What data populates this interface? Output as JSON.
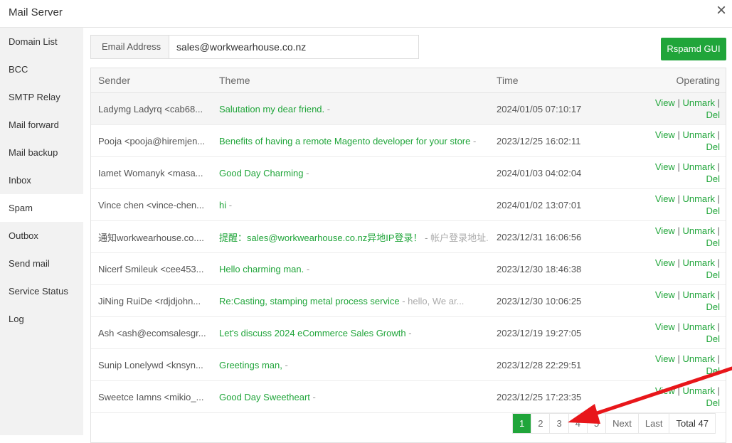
{
  "window": {
    "title": "Mail Server",
    "close_icon": "×"
  },
  "sidebar": {
    "items": [
      {
        "label": "Domain List"
      },
      {
        "label": "BCC"
      },
      {
        "label": "SMTP Relay"
      },
      {
        "label": "Mail forward"
      },
      {
        "label": "Mail backup"
      },
      {
        "label": "Inbox"
      },
      {
        "label": "Spam",
        "active": true
      },
      {
        "label": "Outbox"
      },
      {
        "label": "Send mail"
      },
      {
        "label": "Service Status"
      },
      {
        "label": "Log"
      }
    ]
  },
  "email": {
    "label": "Email Address",
    "value": "sales@workwearhouse.co.nz"
  },
  "rspamd_button": "Rspamd GUI",
  "table": {
    "headers": {
      "sender": "Sender",
      "theme": "Theme",
      "time": "Time",
      "operating": "Operating"
    },
    "actions": {
      "view": "View",
      "unmark": "Unmark",
      "del": "Del",
      "separator": "|"
    },
    "rows": [
      {
        "sender": "Ladymg Ladyrq <cab68...",
        "subject": "Salutation my dear friend.",
        "sep": " -",
        "body": "",
        "time": "2024/01/05 07:10:17"
      },
      {
        "sender": "Pooja <pooja@hiremjen...",
        "subject": "Benefits of having a remote Magento developer for your store",
        "sep": " -",
        "body": "",
        "time": "2023/12/25 16:02:11"
      },
      {
        "sender": "Iamet Womanyk <masa...",
        "subject": "Good Day Charming",
        "sep": " -",
        "body": "",
        "time": "2024/01/03 04:02:04"
      },
      {
        "sender": "Vince chen <vince-chen...",
        "subject": "hi",
        "sep": " -",
        "body": "",
        "time": "2024/01/02 13:07:01"
      },
      {
        "sender": "通知workwearhouse.co....",
        "subject": "提醒：sales@workwearhouse.co.nz异地IP登录！",
        "sep": " -",
        "body": " 帐户登录地址...",
        "time": "2023/12/31 16:06:56"
      },
      {
        "sender": "Nicerf Smileuk <cee453...",
        "subject": "Hello charming man.",
        "sep": " -",
        "body": "",
        "time": "2023/12/30 18:46:38"
      },
      {
        "sender": "JiNing RuiDe <rdjdjohn...",
        "subject": "Re:Casting, stamping metal process service",
        "sep": " -",
        "body": " hello,       We ar...",
        "time": "2023/12/30 10:06:25"
      },
      {
        "sender": "Ash <ash@ecomsalesgr...",
        "subject": "Let's discuss 2024 eCommerce Sales Growth",
        "sep": " -",
        "body": "",
        "time": "2023/12/19 19:27:05"
      },
      {
        "sender": "Sunip Lonelywd <knsyn...",
        "subject": "Greetings man,",
        "sep": " -",
        "body": "",
        "time": "2023/12/28 22:29:51"
      },
      {
        "sender": "Sweetce Iamns <mikio_...",
        "subject": "Good Day Sweetheart",
        "sep": " -",
        "body": "",
        "time": "2023/12/25 17:23:35"
      }
    ]
  },
  "pagination": {
    "pages": [
      "1",
      "2",
      "3",
      "4",
      "5"
    ],
    "current": "1",
    "next": "Next",
    "last": "Last",
    "total": "Total 47"
  },
  "colors": {
    "accent": "#20a53a",
    "annotation_arrow": "#e8161a"
  }
}
